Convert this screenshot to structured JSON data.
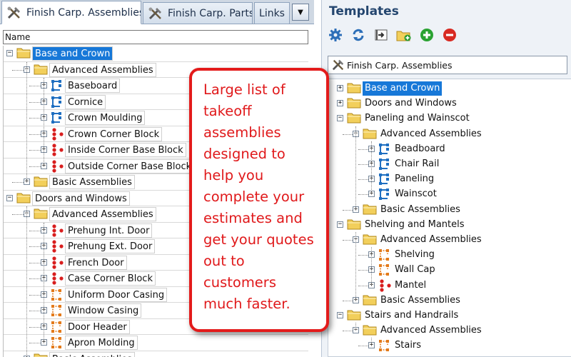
{
  "left_pane": {
    "tabs": [
      {
        "label": "Finish Carp. Assemblies",
        "active": true
      },
      {
        "label": "Finish Carp. Parts",
        "active": false
      },
      {
        "label": "Links",
        "active": false
      }
    ],
    "more_tabs_icon": "triangle-down-icon",
    "column_header": "Name",
    "tree": [
      {
        "label": "Base and Crown",
        "type": "folder",
        "depth": 0,
        "expanded": true,
        "selected": true
      },
      {
        "label": "Advanced Assemblies",
        "type": "folder",
        "depth": 1,
        "expanded": true
      },
      {
        "label": "Baseboard",
        "type": "blue",
        "depth": 2
      },
      {
        "label": "Cornice",
        "type": "blue",
        "depth": 2
      },
      {
        "label": "Crown Moulding",
        "type": "blue",
        "depth": 2
      },
      {
        "label": "Crown Corner Block",
        "type": "red",
        "depth": 2
      },
      {
        "label": "Inside Corner Base Block",
        "type": "red",
        "depth": 2
      },
      {
        "label": "Outside Corner Base Block",
        "type": "red",
        "depth": 2
      },
      {
        "label": "Basic Assemblies",
        "type": "folder",
        "depth": 1,
        "expanded": false
      },
      {
        "label": "Doors and Windows",
        "type": "folder",
        "depth": 0,
        "expanded": true
      },
      {
        "label": "Advanced Assemblies",
        "type": "folder",
        "depth": 1,
        "expanded": true
      },
      {
        "label": "Prehung Int. Door",
        "type": "red",
        "depth": 2
      },
      {
        "label": "Prehung Ext. Door",
        "type": "red",
        "depth": 2
      },
      {
        "label": "French Door",
        "type": "red",
        "depth": 2
      },
      {
        "label": "Case Corner Block",
        "type": "red",
        "depth": 2
      },
      {
        "label": "Uniform Door Casing",
        "type": "orange",
        "depth": 2
      },
      {
        "label": "Window Casing",
        "type": "orange",
        "depth": 2
      },
      {
        "label": "Door Header",
        "type": "orange",
        "depth": 2
      },
      {
        "label": "Apron Molding",
        "type": "orange",
        "depth": 2
      },
      {
        "label": "Basic Assemblies",
        "type": "folder",
        "depth": 1,
        "expanded": false
      }
    ]
  },
  "right_pane": {
    "title": "Templates",
    "toolbar": [
      {
        "icon": "gear-icon"
      },
      {
        "icon": "refresh-icon"
      },
      {
        "icon": "import-icon"
      },
      {
        "icon": "new-folder-icon"
      },
      {
        "icon": "add-icon"
      },
      {
        "icon": "remove-icon"
      }
    ],
    "combo_value": "Finish Carp. Assemblies",
    "tree": [
      {
        "label": "Base and Crown",
        "type": "folder",
        "depth": 0,
        "expanded": false,
        "selected": true
      },
      {
        "label": "Doors and Windows",
        "type": "folder",
        "depth": 0,
        "expanded": false
      },
      {
        "label": "Paneling and Wainscot",
        "type": "folder",
        "depth": 0,
        "expanded": true
      },
      {
        "label": "Advanced Assemblies",
        "type": "folder",
        "depth": 1,
        "expanded": true
      },
      {
        "label": "Beadboard",
        "type": "blue",
        "depth": 2
      },
      {
        "label": "Chair Rail",
        "type": "blue",
        "depth": 2
      },
      {
        "label": "Paneling",
        "type": "blue",
        "depth": 2
      },
      {
        "label": "Wainscot",
        "type": "blue",
        "depth": 2
      },
      {
        "label": "Basic Assemblies",
        "type": "folder",
        "depth": 1,
        "expanded": false
      },
      {
        "label": "Shelving and Mantels",
        "type": "folder",
        "depth": 0,
        "expanded": true
      },
      {
        "label": "Advanced Assemblies",
        "type": "folder",
        "depth": 1,
        "expanded": true
      },
      {
        "label": "Shelving",
        "type": "orange",
        "depth": 2
      },
      {
        "label": "Wall Cap",
        "type": "orange",
        "depth": 2
      },
      {
        "label": "Mantel",
        "type": "red",
        "depth": 2
      },
      {
        "label": "Basic Assemblies",
        "type": "folder",
        "depth": 1,
        "expanded": false
      },
      {
        "label": "Stairs and Handrails",
        "type": "folder",
        "depth": 0,
        "expanded": true
      },
      {
        "label": "Advanced Assemblies",
        "type": "folder",
        "depth": 1,
        "expanded": true
      },
      {
        "label": "Stairs",
        "type": "orange",
        "depth": 2
      }
    ]
  },
  "callout": {
    "lines": [
      "Large list of",
      "takeoff",
      "assemblies",
      "designed to",
      "help you",
      "complete your",
      "estimates and",
      "get your quotes",
      "out to",
      "customers",
      "much faster."
    ]
  },
  "colors": {
    "selection": "#1778d8",
    "callout": "#e31b1b",
    "folder": "#f2cf5b",
    "blue_icon": "#1f6fc1",
    "red_icon": "#d81e1e",
    "orange_icon": "#e37a1a"
  }
}
